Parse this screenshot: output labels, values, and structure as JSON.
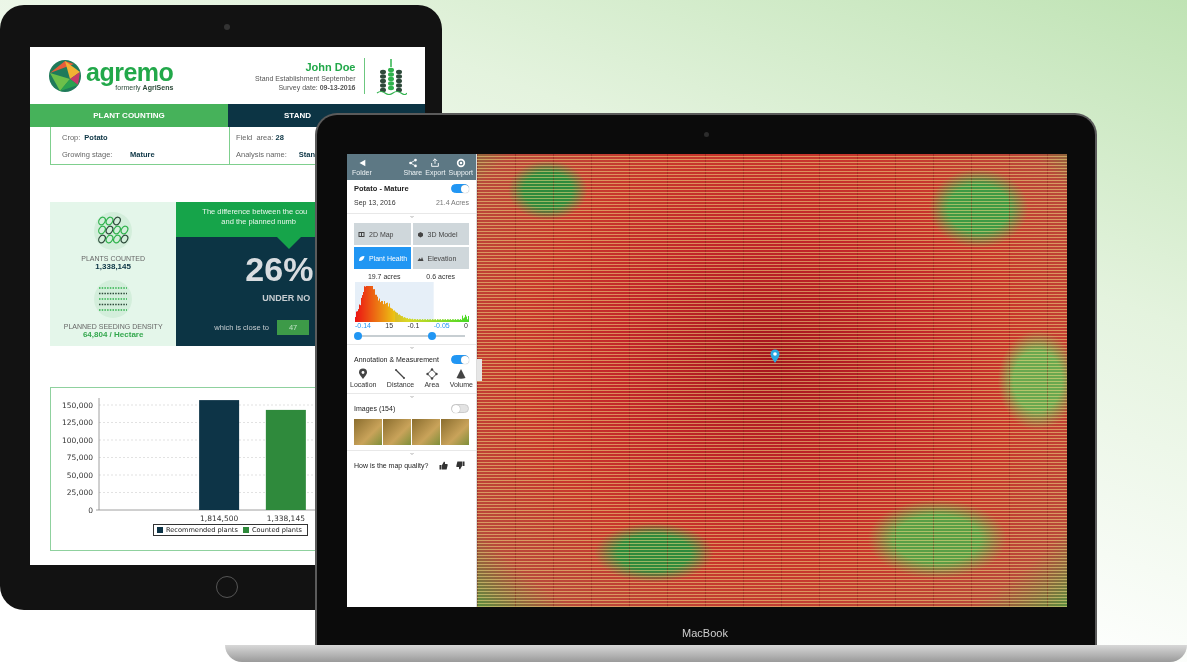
{
  "tablet": {
    "logo": {
      "name": "agremo",
      "tagline": "formerly **AgriSens**"
    },
    "report_header": {
      "name": "John Doe",
      "subtitle": "Stand Establishment September",
      "survey_date": "Survey date:  **09-13-2016**"
    },
    "tabs": [
      {
        "label": "PLANT COUNTING",
        "selected": true
      },
      {
        "label": "STAND",
        "selected": false
      }
    ],
    "field_info": [
      {
        "label": "Crop:",
        "value": "Potato"
      },
      {
        "label": "Growing stage:",
        "value": "Mature"
      },
      {
        "label": "Field  area:",
        "value": "28"
      },
      {
        "label": "Analysis name:",
        "value": "Stan"
      }
    ],
    "stats": {
      "plants_counted_label": "PLANTS COUNTED",
      "plants_counted": "1,338,145",
      "density_label": "PLANNED SEEDING DENSITY",
      "density": "64,804 / Hectare"
    },
    "difference": {
      "message_lines": [
        "The difference between the cou",
        "and the planned numb"
      ],
      "percent": "26%",
      "verdict": "UNDER NO",
      "close_to_label": "which is close to",
      "close_to_value": "47"
    },
    "chart": {
      "chart_data": {
        "type": "bar",
        "categories": [
          "1,814,500",
          "1,338,145"
        ],
        "series": [
          {
            "name": "Recommended plants",
            "color": "#0d3447",
            "values": [
              157000,
              null
            ]
          },
          {
            "name": "Counted plants",
            "color": "#2f8a3c",
            "values": [
              null,
              143000
            ]
          }
        ],
        "ylim": [
          0,
          160000
        ],
        "grid": true,
        "yticks": [
          {
            "value": 0,
            "label": "0"
          },
          {
            "value": 25000,
            "label": "25,000"
          },
          {
            "value": 50000,
            "label": "50,000"
          },
          {
            "value": 75000,
            "label": "75,000"
          },
          {
            "value": 100000,
            "label": "100,000"
          },
          {
            "value": 125000,
            "label": "125,000"
          },
          {
            "value": 150000,
            "label": "150,000"
          }
        ]
      }
    }
  },
  "laptop": {
    "brand": "MacBook",
    "toolbar": [
      {
        "kind": "back",
        "label": "Folder"
      },
      {
        "kind": "share",
        "label": "Share"
      },
      {
        "kind": "export",
        "label": "Export"
      },
      {
        "kind": "support",
        "label": "Support"
      }
    ],
    "project": {
      "title": "Potato - Mature",
      "on": true,
      "date": "Sep 13, 2016",
      "area": "21.4 Acres"
    },
    "modes": [
      {
        "kind": "map",
        "label": "2D Map",
        "selected": false
      },
      {
        "kind": "model",
        "label": "3D Model",
        "selected": false
      },
      {
        "kind": "health",
        "label": "Plant Health",
        "selected": true
      },
      {
        "kind": "elevation",
        "label": "Elevation",
        "selected": false
      }
    ],
    "histogram": {
      "left_area": "19.7 acres",
      "right_area": "0.6 acres",
      "axis_labels": [
        {
          "text": "-0.14",
          "highlighted": true
        },
        {
          "text": "15",
          "highlighted": false
        },
        {
          "text": "-0.1",
          "highlighted": false
        },
        {
          "text": "-0.05",
          "highlighted": true
        },
        {
          "text": "0",
          "highlighted": false
        }
      ],
      "thumbs": [
        {
          "level": 0
        },
        {
          "level": 0.69
        }
      ]
    },
    "annotation": {
      "title": "Annotation & Measurement",
      "on": true,
      "tools": [
        {
          "kind": "location",
          "label": "Location"
        },
        {
          "kind": "distance",
          "label": "Distance"
        },
        {
          "kind": "area",
          "label": "Area"
        },
        {
          "kind": "volume",
          "label": "Volume"
        }
      ]
    },
    "images": {
      "title": "Images (154)",
      "on": false
    },
    "feedback": {
      "question": "How is the map quality?"
    }
  }
}
